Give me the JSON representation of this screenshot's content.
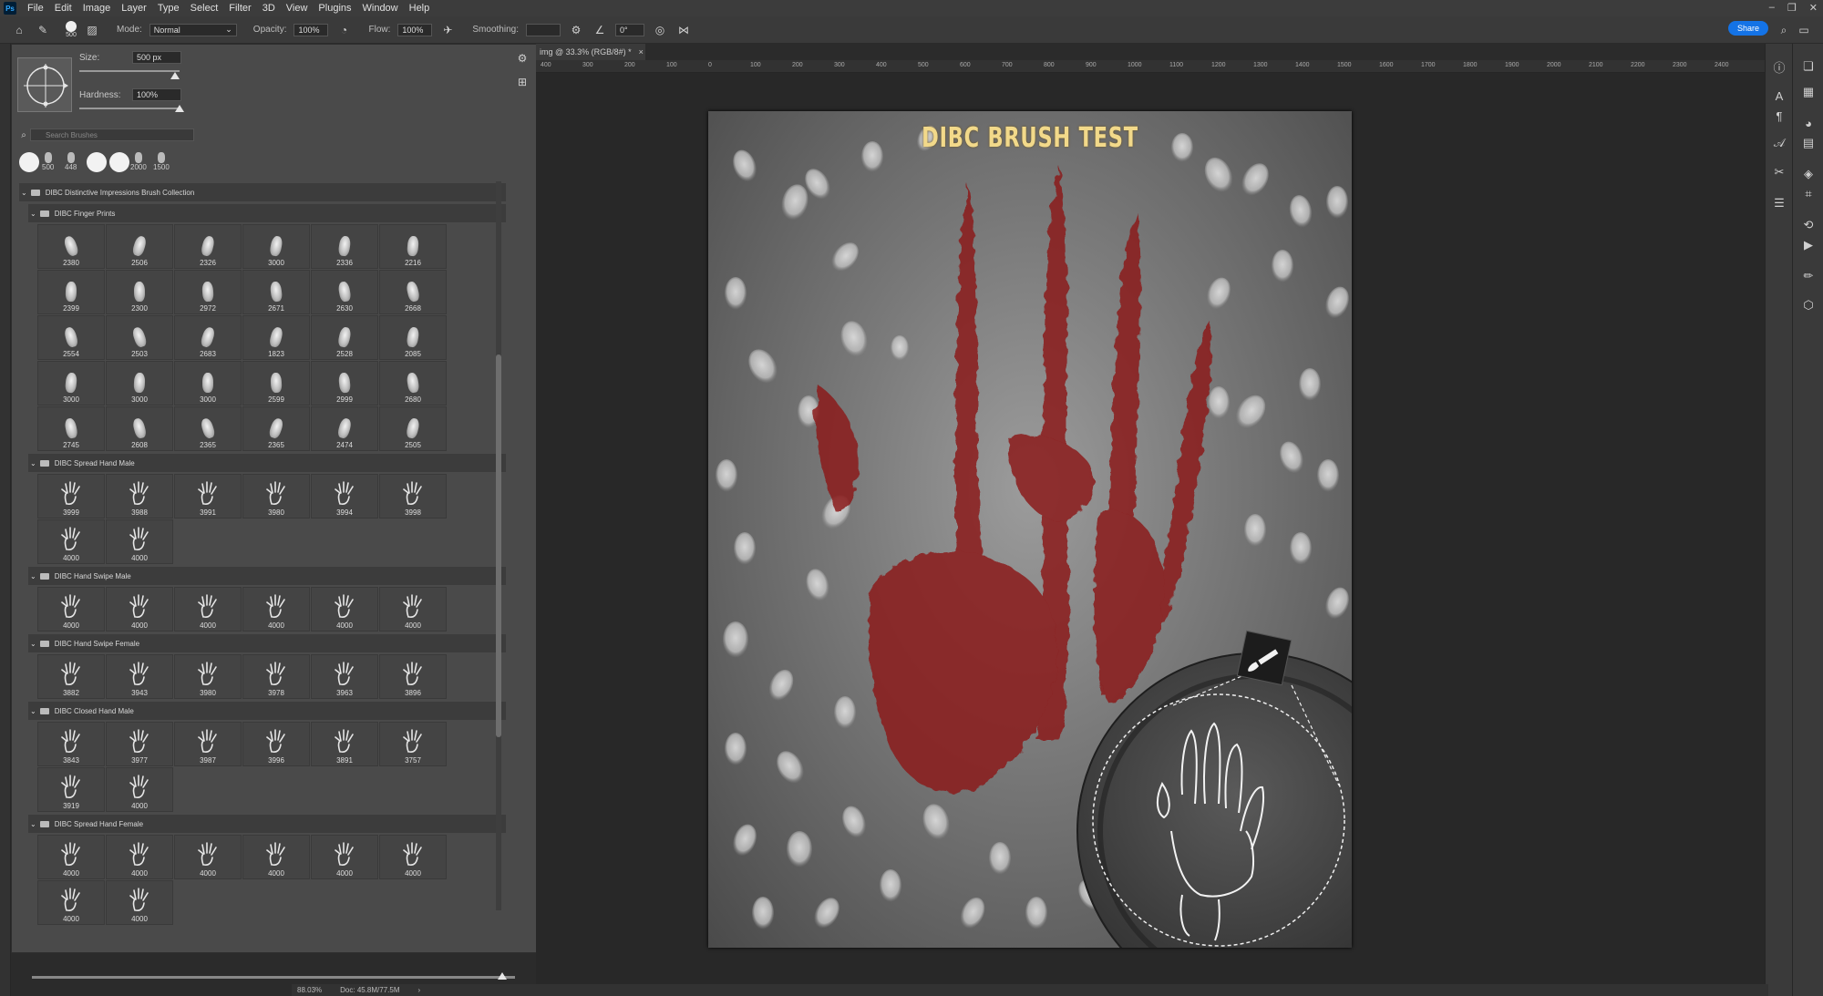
{
  "menubar": {
    "logo": "Ps",
    "items": [
      "File",
      "Edit",
      "Image",
      "Layer",
      "Type",
      "Select",
      "Filter",
      "3D",
      "View",
      "Plugins",
      "Window",
      "Help"
    ]
  },
  "options": {
    "brush_size": "500",
    "mode_label": "Mode:",
    "mode_value": "Normal",
    "opacity_label": "Opacity:",
    "opacity_value": "100%",
    "flow_label": "Flow:",
    "flow_value": "100%",
    "smoothing_label": "Smoothing:",
    "angle_value": "0°",
    "share_label": "Share"
  },
  "brush_settings": {
    "size_label": "Size:",
    "size_value": "500 px",
    "hardness_label": "Hardness:",
    "hardness_value": "100%",
    "size_fraction": 0.95,
    "hardness_fraction": 1.0,
    "search_placeholder": "Search Brushes"
  },
  "recent_brushes": [
    {
      "size": ""
    },
    {
      "size": "500"
    },
    {
      "size": "448"
    },
    {
      "size": ""
    },
    {
      "size": ""
    },
    {
      "size": "2000"
    },
    {
      "size": "1500"
    }
  ],
  "collection_title": "DIBC Distinctive Impressions Brush Collection",
  "groups": [
    {
      "name": "DIBC Finger Prints",
      "kind": "finger",
      "brushes": [
        "2380",
        "2506",
        "2326",
        "3000",
        "2336",
        "2216",
        "2399",
        "2300",
        "2972",
        "2671",
        "2630",
        "2668",
        "2554",
        "2503",
        "2683",
        "1823",
        "2528",
        "2085",
        "3000",
        "3000",
        "3000",
        "2599",
        "2999",
        "2680",
        "2745",
        "2608",
        "2365",
        "2365",
        "2474",
        "2505"
      ]
    },
    {
      "name": "DIBC Spread Hand Male",
      "kind": "hand",
      "brushes": [
        "3999",
        "3988",
        "3991",
        "3980",
        "3994",
        "3998",
        "4000",
        "4000"
      ]
    },
    {
      "name": "DIBC Hand Swipe Male",
      "kind": "hand",
      "brushes": [
        "4000",
        "4000",
        "4000",
        "4000",
        "4000",
        "4000"
      ]
    },
    {
      "name": "DIBC Hand Swipe Female",
      "kind": "hand",
      "brushes": [
        "3882",
        "3943",
        "3980",
        "3978",
        "3963",
        "3896"
      ]
    },
    {
      "name": "DIBC Closed Hand Male",
      "kind": "hand",
      "brushes": [
        "3843",
        "3977",
        "3987",
        "3996",
        "3891",
        "3757",
        "3919",
        "4000"
      ]
    },
    {
      "name": "DIBC Spread Hand Female",
      "kind": "hand",
      "brushes": [
        "4000",
        "4000",
        "4000",
        "4000",
        "4000",
        "4000",
        "4000",
        "4000"
      ]
    }
  ],
  "document": {
    "tab_title": "img @ 33.3% (RGB/8#) *",
    "canvas_title": "DIBC BRUSH TEST"
  },
  "ruler_ticks": [
    "400",
    "300",
    "200",
    "100",
    "0",
    "100",
    "200",
    "300",
    "400",
    "500",
    "600",
    "700",
    "800",
    "900",
    "1000",
    "1100",
    "1200",
    "1300",
    "1400",
    "1500",
    "1600",
    "1700",
    "1800",
    "1900",
    "2000",
    "2100",
    "2200",
    "2300",
    "2400"
  ],
  "status": {
    "zoom": "88.03%",
    "doc": "Doc: 45.8M/77.5M"
  },
  "colors": {
    "accent": "#1473e6",
    "blood": "#8b1a1a",
    "title_gold": "#f2d98a"
  }
}
